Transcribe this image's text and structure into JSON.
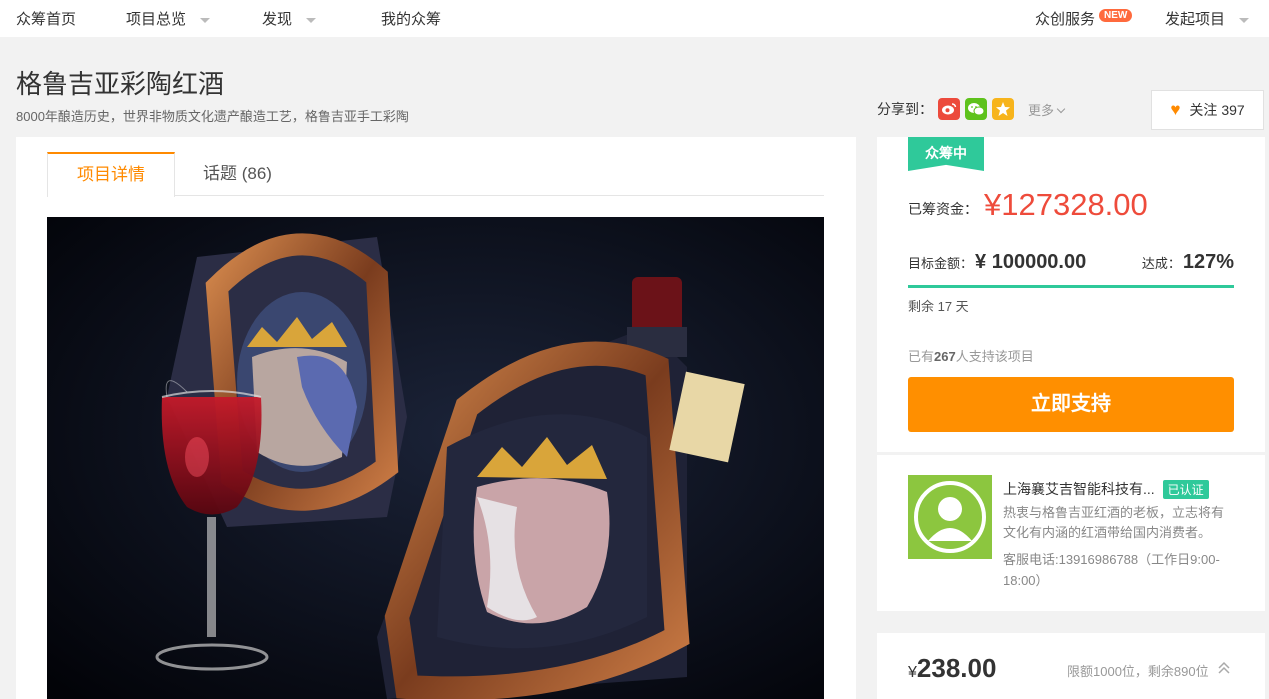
{
  "nav": {
    "home": "众筹首页",
    "overview": "项目总览",
    "discover": "发现",
    "mine": "我的众筹",
    "service": "众创服务",
    "new_badge": "NEW",
    "launch": "发起项目"
  },
  "project": {
    "title": "格鲁吉亚彩陶红酒",
    "subtitle": "8000年酿造历史，世界非物质文化遗产酿造工艺，格鲁吉亚手工彩陶"
  },
  "share": {
    "label": "分享到：",
    "more": "更多",
    "icons": [
      "weibo-icon",
      "wechat-icon",
      "qzone-icon"
    ]
  },
  "follow": {
    "label": "关注",
    "count": "397"
  },
  "tabs": {
    "details": "项目详情",
    "topics": "话题 (86)"
  },
  "funding": {
    "status": "众筹中",
    "raised_label": "已筹资金：",
    "raised_amount": "¥127328.00",
    "target_label": "目标金额：",
    "target_amount": "¥ 100000.00",
    "rate_label": "达成：",
    "rate_value": "127%",
    "progress_fraction": 1.0,
    "remaining": "剩余 17 天",
    "backers_prefix": "已有",
    "backers_count": "267",
    "backers_suffix": "人支持该项目",
    "support_button": "立即支持"
  },
  "owner": {
    "name": "上海襄艾吉智能科技有...",
    "verified": "已认证",
    "description": "热衷与格鲁吉亚红酒的老板，立志将有文化有内涵的红酒带给国内消费者。",
    "phone": "客服电话:13916986788（工作日9:00-18:00）"
  },
  "reward": {
    "currency": "¥",
    "price": "238.00",
    "limit": "限额1000位，剩余890位"
  },
  "colors": {
    "accent_orange": "#ff8f00",
    "raised_red": "#ee4b3b",
    "status_green": "#2fc99a"
  }
}
